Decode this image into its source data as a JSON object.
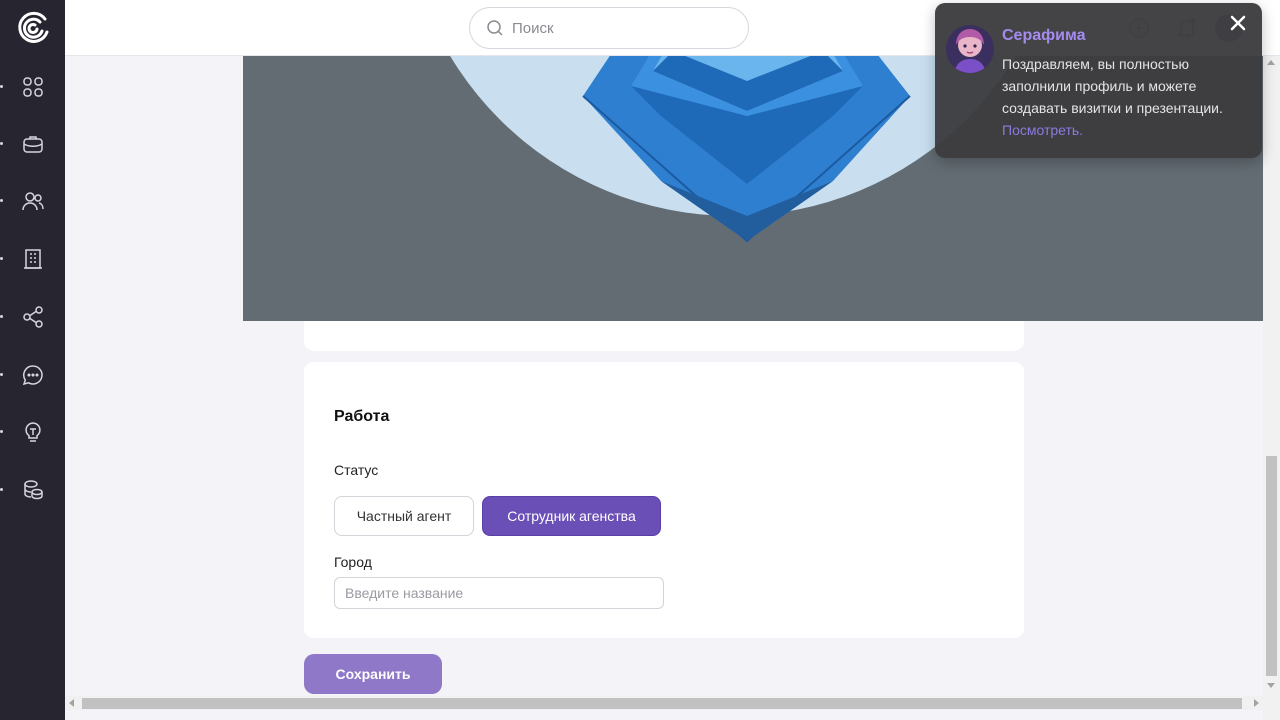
{
  "sidebar": {
    "logo": "logo-icon",
    "items": [
      {
        "name": "dashboard",
        "icon": "grid-icon"
      },
      {
        "name": "briefcase",
        "icon": "briefcase-icon"
      },
      {
        "name": "users",
        "icon": "users-icon"
      },
      {
        "name": "buildings",
        "icon": "building-icon"
      },
      {
        "name": "share",
        "icon": "share-icon"
      },
      {
        "name": "chat",
        "icon": "chat-icon"
      },
      {
        "name": "ideas",
        "icon": "lightbulb-icon"
      },
      {
        "name": "database",
        "icon": "database-icon"
      }
    ]
  },
  "header": {
    "search_placeholder": "Поиск",
    "icons": [
      "plus-circle-icon",
      "bell-icon",
      "avatar"
    ]
  },
  "work": {
    "title": "Работа",
    "status_label": "Статус",
    "status_options": [
      "Частный агент",
      "Сотрудник агенства"
    ],
    "status_selected": "Сотрудник агенства",
    "city_label": "Город",
    "city_placeholder": "Введите название",
    "city_value": ""
  },
  "save_label": "Сохранить",
  "toast": {
    "name": "Серафима",
    "message": "Поздравляем, вы полностью заполнили профиль и можете создавать визитки и презентации.",
    "link_text": "Посмотреть."
  },
  "colors": {
    "sidebar_bg": "#27252f",
    "accent": "#6a4fb6",
    "save_button": "#8f78c8",
    "toast_name": "#a58bf0",
    "banner_bg": "#636c73"
  }
}
